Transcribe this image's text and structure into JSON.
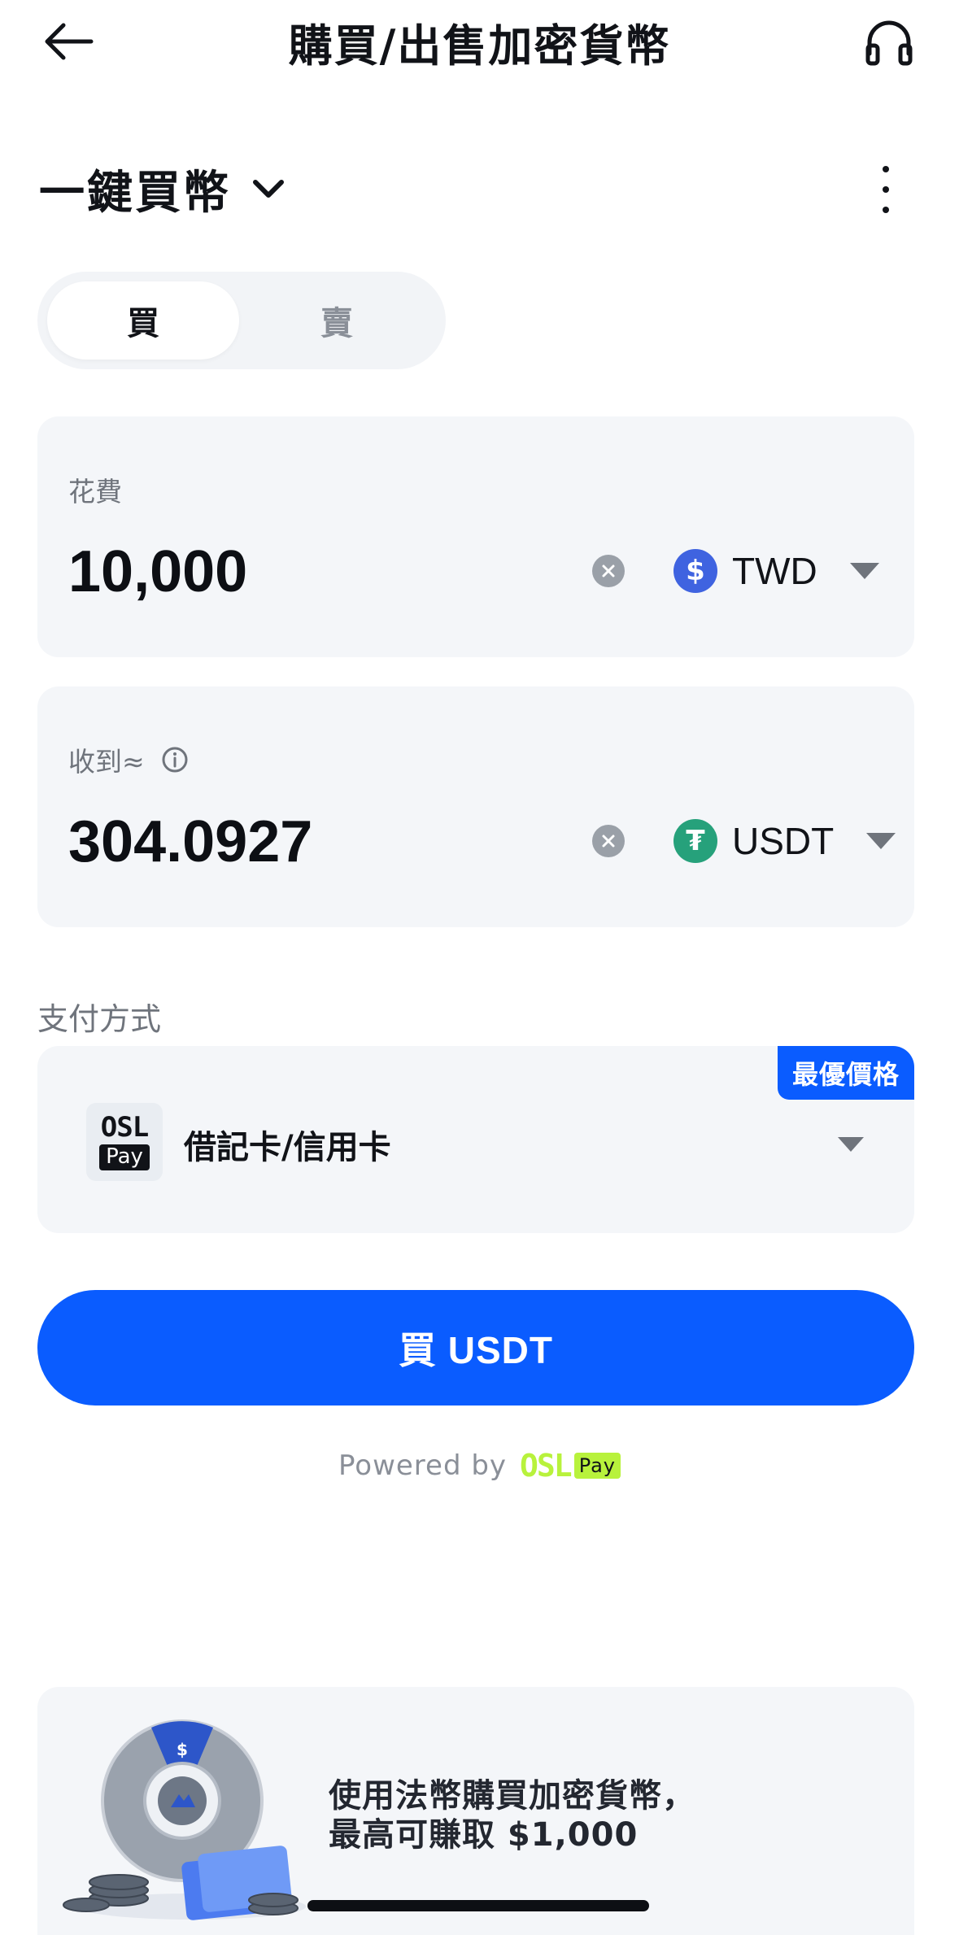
{
  "header": {
    "title": "購買/出售加密貨幣",
    "back_icon": "arrow-left-icon",
    "support_icon": "headset-icon"
  },
  "mode": {
    "title": "一鍵買幣",
    "chevron_icon": "chevron-down-icon",
    "more_icon": "more-vertical-icon"
  },
  "tabs": [
    {
      "label": "買",
      "active": true
    },
    {
      "label": "賣",
      "active": false
    }
  ],
  "spend": {
    "label": "花費",
    "amount": "10,000",
    "currency": "TWD",
    "coin_symbol": "$",
    "coin_color": "#3f63e0"
  },
  "receive": {
    "label": "收到≈",
    "amount": "304.0927",
    "currency": "USDT",
    "coin_symbol": "₮",
    "coin_color": "#26a17b"
  },
  "payment": {
    "section_label": "支付方式",
    "method": "借記卡/信用卡",
    "badge": "最優價格",
    "logo_text": "OSL",
    "logo_sub": "Pay"
  },
  "buy_button": "買 USDT",
  "powered_by": {
    "text": "Powered by",
    "brand": "OSL",
    "brand_sub": "Pay"
  },
  "promo": {
    "line1": "使用法幣購買加密貨幣，",
    "line2": "最高可賺取 $1,000",
    "wheel_symbol": "$"
  },
  "colors": {
    "accent": "#0a5cff",
    "osl_green": "#b8f23c",
    "card_bg": "#f4f6f9"
  }
}
